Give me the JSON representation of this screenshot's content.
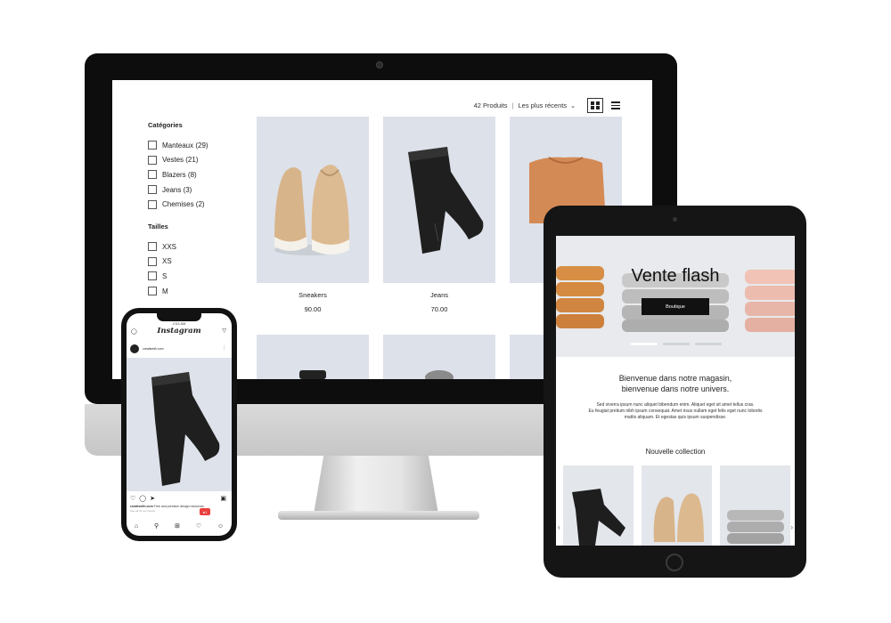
{
  "desktop": {
    "toolbar": {
      "product_count": "42 Produits",
      "separator": "|",
      "sort_label": "Les plus récents",
      "sort_icon": "chevron-down-icon",
      "view_grid_icon": "grid-view-icon",
      "view_list_icon": "list-view-icon"
    },
    "filters": {
      "categories_title": "Catégories",
      "categories": [
        {
          "label": "Manteaux (29)"
        },
        {
          "label": "Vestes (21)"
        },
        {
          "label": "Blazers (8)"
        },
        {
          "label": "Jeans (3)"
        },
        {
          "label": "Chemises (2)"
        }
      ],
      "sizes_title": "Tailles",
      "sizes": [
        {
          "label": "XXS"
        },
        {
          "label": "XS"
        },
        {
          "label": "S"
        },
        {
          "label": "M"
        }
      ]
    },
    "products": [
      {
        "name": "Sneakers",
        "price": "90.00"
      },
      {
        "name": "Jeans",
        "price": "70.00"
      },
      {
        "name": "",
        "price": ""
      }
    ]
  },
  "tablet": {
    "hero_title": "Vente flash",
    "hero_button": "Boutique",
    "welcome_line1": "Bienvenue dans notre magasin,",
    "welcome_line2": "bienvenue dans notre univers.",
    "lorem_line1": "Sed viverra ipsum nunc aliquet bibendum enim. Aliquet eget sit amet tellus cras.",
    "lorem_line2": "Eu feugiat pretium nibh ipsum consequat. Amet risus nullam eget felis eget nunc lobortis",
    "lorem_line3": "mattis aliquam. Et egestas quis ipsum suspendisse.",
    "collection_title": "Nouvelle collection",
    "prev_arrow": "‹",
    "next_arrow": "›"
  },
  "phone": {
    "time": "2:53 AM",
    "app_name": "Instagram",
    "username": "creativeith.com",
    "caption_user": "creativeith.com",
    "caption_text": "Free and premium  design resources",
    "comments_text": "See all 31 comments",
    "notification_count": "1",
    "colors": {
      "badge": "#e8403f"
    }
  }
}
